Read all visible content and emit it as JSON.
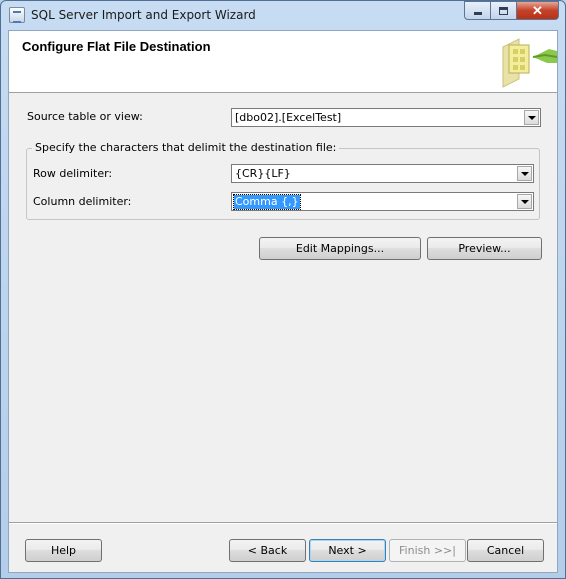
{
  "window": {
    "title": "SQL Server Import and Export Wizard"
  },
  "header": {
    "page_title": "Configure Flat File Destination",
    "graphic_icon": "folder-document-wizard-icon"
  },
  "source": {
    "label": "Source table or view:",
    "value": "[dbo02].[ExcelTest]"
  },
  "delimiters": {
    "group_title": "Specify the characters that delimit the destination file:",
    "row_label": "Row delimiter:",
    "row_value": "{CR}{LF}",
    "column_label": "Column delimiter:",
    "column_value": "Comma {,}"
  },
  "actions": {
    "edit_mappings": "Edit Mappings...",
    "preview": "Preview..."
  },
  "footer": {
    "help": "Help",
    "back": "< Back",
    "next": "Next >",
    "finish": "Finish >>|",
    "cancel": "Cancel"
  },
  "colors": {
    "selection": "#3399ff",
    "window_frame": "#bcd3ec",
    "close_button": "#c4412a"
  }
}
